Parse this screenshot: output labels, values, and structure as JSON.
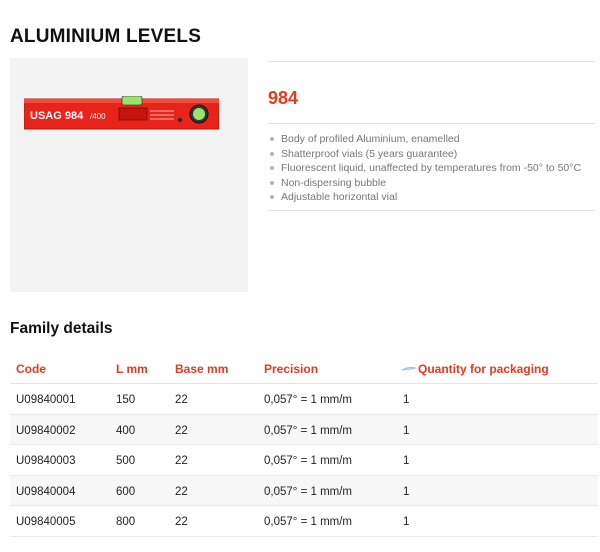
{
  "page": {
    "title": "ALUMINIUM LEVELS"
  },
  "product": {
    "code": "984",
    "tool_brand": "USAG 984",
    "tool_size": "/400",
    "features": [
      "Body of profiled Aluminium, enamelled",
      "Shatterproof vials (5 years guarantee)",
      "Fluorescent liquid, unaffected by temperatures from -50° to 50°C",
      "Non-dispersing bubble",
      "Adjustable horizontal vial"
    ]
  },
  "family": {
    "heading": "Family details",
    "columns": [
      "Code",
      "L mm",
      "Base mm",
      "Precision",
      "Quantity for packaging"
    ],
    "rows": [
      {
        "code": "U09840001",
        "l_mm": "150",
        "base_mm": "22",
        "precision": "0,057° = 1 mm/m",
        "qty": "1"
      },
      {
        "code": "U09840002",
        "l_mm": "400",
        "base_mm": "22",
        "precision": "0,057° = 1 mm/m",
        "qty": "1"
      },
      {
        "code": "U09840003",
        "l_mm": "500",
        "base_mm": "22",
        "precision": "0,057° = 1 mm/m",
        "qty": "1"
      },
      {
        "code": "U09840004",
        "l_mm": "600",
        "base_mm": "22",
        "precision": "0,057° = 1 mm/m",
        "qty": "1"
      },
      {
        "code": "U09840005",
        "l_mm": "800",
        "base_mm": "22",
        "precision": "0,057° = 1 mm/m",
        "qty": "1"
      }
    ]
  },
  "colors": {
    "accent": "#e03c1f",
    "tool_red": "#e8231a",
    "vial_green": "#9be26a"
  },
  "icons": {
    "packaging": "packaging-icon"
  }
}
